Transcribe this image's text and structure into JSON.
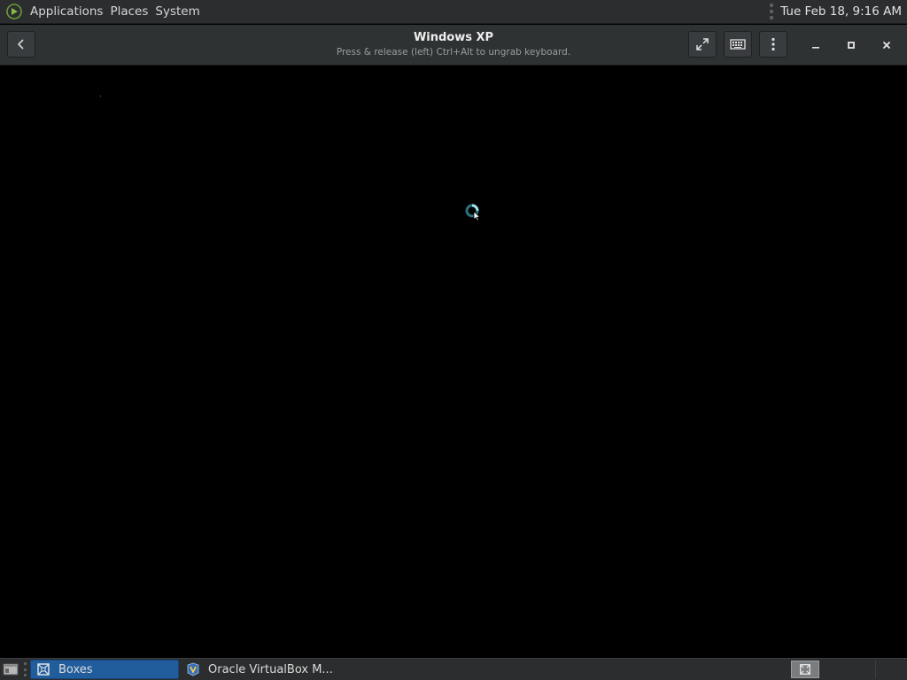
{
  "top_panel": {
    "menus": [
      "Applications",
      "Places",
      "System"
    ],
    "clock": "Tue Feb 18,  9:16 AM"
  },
  "headerbar": {
    "title": "Windows XP",
    "subtitle": "Press & release (left) Ctrl+Alt to ungrab keyboard."
  },
  "taskbar": {
    "tasks": [
      {
        "label": "Boxes",
        "icon": "boxes-icon",
        "active": true
      },
      {
        "label": "Oracle VirtualBox M...",
        "icon": "virtualbox-icon",
        "active": false
      }
    ]
  },
  "colors": {
    "panel": "#2b2d2e",
    "headerbar": "#2f3233",
    "active_task": "#215d9c",
    "spinner": "#5fb8c8"
  }
}
